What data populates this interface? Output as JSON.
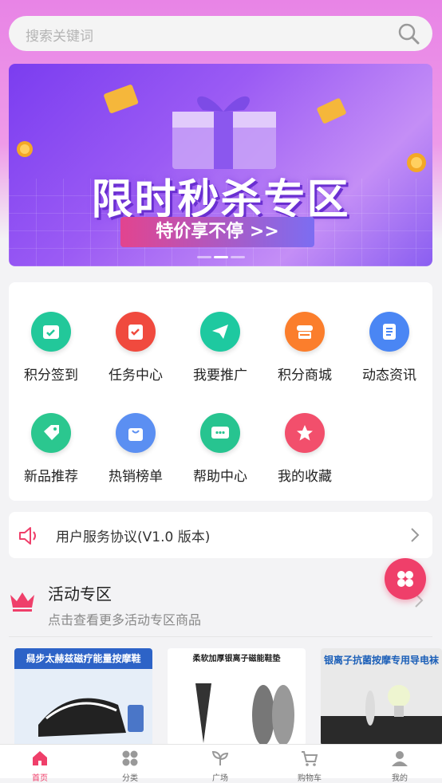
{
  "search": {
    "placeholder": "搜索关键词"
  },
  "banner": {
    "title": "限时秒杀专区",
    "subtitle": "特价享不停 >>",
    "colors": {
      "bg_start": "#7b3df0",
      "bg_end": "#c48ef6"
    }
  },
  "menu": {
    "items": [
      {
        "label": "积分签到",
        "icon": "calendar-check-icon",
        "color": "#22c89a"
      },
      {
        "label": "任务中心",
        "icon": "task-clipboard-icon",
        "color": "#f04a3e"
      },
      {
        "label": "我要推广",
        "icon": "paper-plane-icon",
        "color": "#1ec9a0"
      },
      {
        "label": "积分商城",
        "icon": "store-icon",
        "color": "#fb7e2c"
      },
      {
        "label": "动态资讯",
        "icon": "news-icon",
        "color": "#4a86f4"
      },
      {
        "label": "新品推荐",
        "icon": "new-tag-icon",
        "color": "#2bc78f"
      },
      {
        "label": "热销榜单",
        "icon": "shopping-bag-icon",
        "color": "#5b8ff2"
      },
      {
        "label": "帮助中心",
        "icon": "chat-bubble-icon",
        "color": "#27c490"
      },
      {
        "label": "我的收藏",
        "icon": "star-icon",
        "color": "#f24f6c"
      }
    ]
  },
  "notice": {
    "text": "用户服务协议(V1.0 版本)"
  },
  "activity": {
    "title": "活动专区",
    "subtitle": "点击查看更多活动专区商品"
  },
  "products": [
    {
      "title": "舄步太赫兹磁疗能量按摩鞋"
    },
    {
      "title": "柔软加厚银离子磁能鞋垫"
    },
    {
      "title": "银离子抗菌按摩专用导电袜"
    }
  ],
  "tabbar": {
    "items": [
      {
        "label": "首页",
        "icon": "home-icon",
        "active": true
      },
      {
        "label": "分类",
        "icon": "grid-icon"
      },
      {
        "label": "广场",
        "icon": "sprout-icon"
      },
      {
        "label": "购物车",
        "icon": "cart-icon"
      },
      {
        "label": "我的",
        "icon": "user-icon"
      }
    ]
  },
  "colors": {
    "accent": "#ef3f6a",
    "header_bg": "#e884e6"
  }
}
